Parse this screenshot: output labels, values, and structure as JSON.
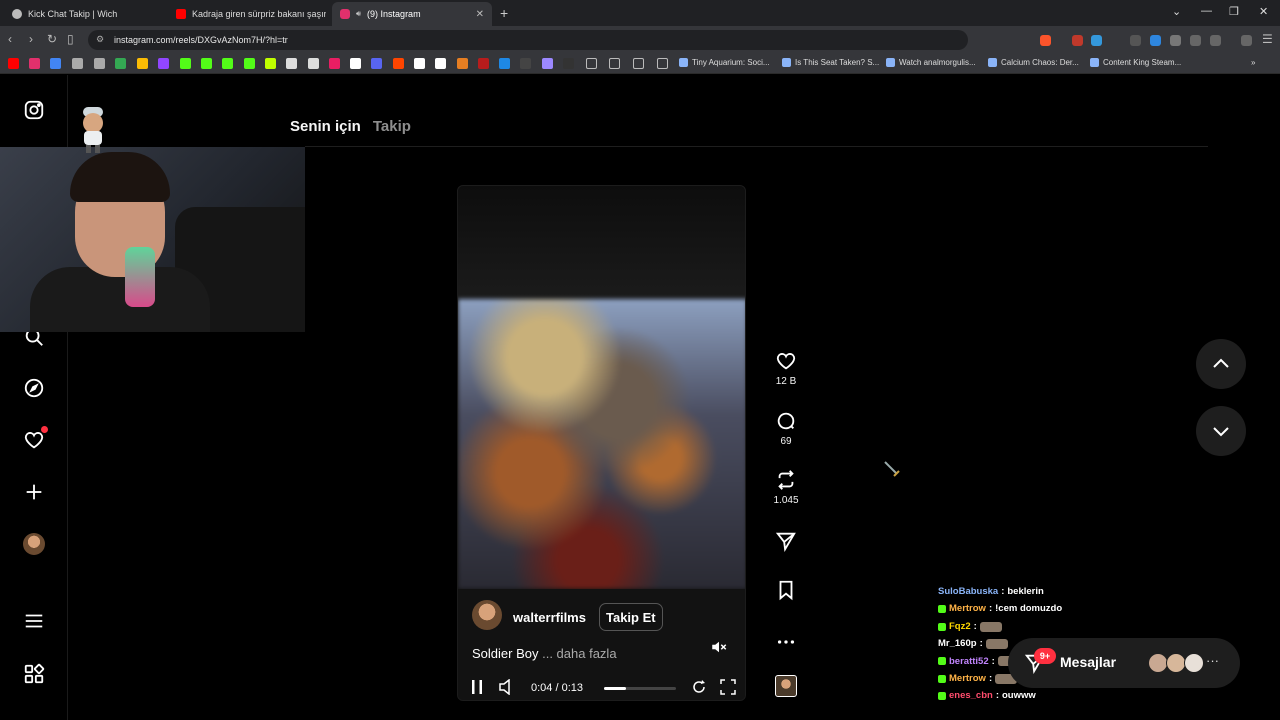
{
  "browser": {
    "tabs": [
      {
        "title": "Kick Chat Takip | Wich",
        "active": false,
        "favicon_color": "#bbbbbb"
      },
      {
        "title": "Kadraja giren sürpriz bakanı şaşırttı",
        "active": false,
        "favicon_color": "#ff0000"
      },
      {
        "title": "(9) Instagram",
        "active": true,
        "favicon_color": "#e1306c"
      }
    ],
    "new_tab_label": "+",
    "url": "instagram.com/reels/DXGvAzNom7H/?hl=tr",
    "bookmarks": [
      {
        "label": "Tiny Aquarium: Soci..."
      },
      {
        "label": "Is This Seat Taken? S..."
      },
      {
        "label": "Watch analmorgulis..."
      },
      {
        "label": "Calcium Chaos: Der..."
      },
      {
        "label": "Content King Steam..."
      }
    ]
  },
  "feed_tabs": {
    "for_you": "Senin için",
    "following": "Takip"
  },
  "reel": {
    "username": "walterrfilms",
    "follow_label": "Takip Et",
    "caption": "Soldier Boy",
    "caption_more": "... daha fazla",
    "time_current": "0:04",
    "time_total": "0:13",
    "progress": 0.31
  },
  "actions": {
    "likes": "12 B",
    "comments": "69",
    "reposts": "1.045"
  },
  "chat": [
    {
      "user": "SuloBabuska",
      "color": "#8ab4f8",
      "message": "beklerin",
      "badge": false,
      "emote": false
    },
    {
      "user": "Mertrow",
      "color": "#ffb347",
      "message": "!cem domuzdo",
      "badge": true,
      "emote": false
    },
    {
      "user": "Fqz2",
      "color": "#ffd700",
      "message": "",
      "badge": true,
      "emote": true
    },
    {
      "user": "Mr_160p",
      "color": "#ffffff",
      "message": "",
      "badge": false,
      "emote": true
    },
    {
      "user": "beratti52",
      "color": "#c084fc",
      "message": "",
      "badge": true,
      "emote": true
    },
    {
      "user": "Mertrow",
      "color": "#ffb347",
      "message": "",
      "badge": true,
      "emote": true
    },
    {
      "user": "enes_cbn",
      "color": "#ff4d6d",
      "message": "ouwww",
      "badge": true,
      "emote": false
    }
  ],
  "messages": {
    "label": "Mesajlar",
    "badge": "9+"
  }
}
